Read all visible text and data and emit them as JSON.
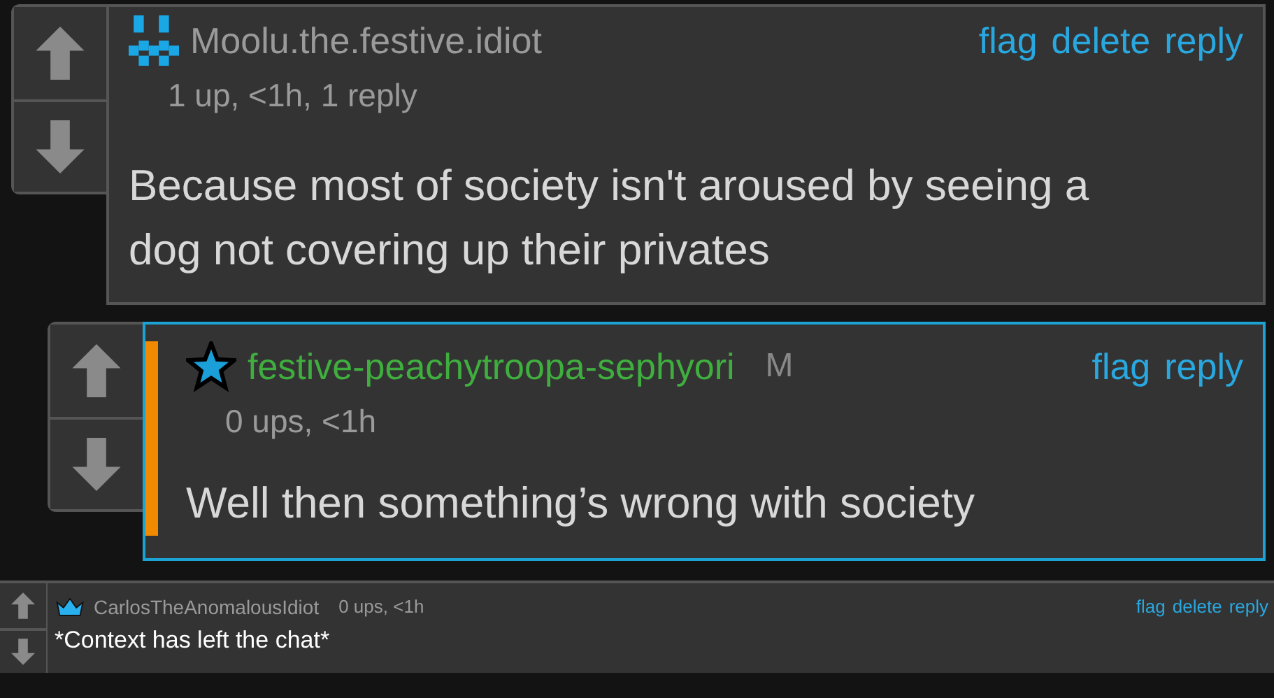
{
  "comments": [
    {
      "kind": "large",
      "author": "Moolu.the.festive.idiot",
      "color": "#9a9a9a",
      "highlighted": false,
      "meta": "1 up, <1h, 1 reply",
      "body": "Because most of society isn't aroused by seeing a dog not covering up their privates",
      "actions": [
        "flag",
        "delete",
        "reply"
      ],
      "children": [
        {
          "kind": "large",
          "author": "festive-peachytroopa-sephyori",
          "color": "#3fae3f",
          "badge": "M",
          "highlighted": true,
          "meta": "0 ups, <1h",
          "body": "Well then something’s wrong with society",
          "actions": [
            "flag",
            "reply"
          ]
        }
      ]
    },
    {
      "kind": "compact",
      "author": "CarlosTheAnomalousIdiot",
      "color": "#9a9a9a",
      "meta": "0 ups, <1h",
      "body": "*Context has left the chat*",
      "actions": [
        "flag",
        "delete",
        "reply"
      ]
    }
  ]
}
